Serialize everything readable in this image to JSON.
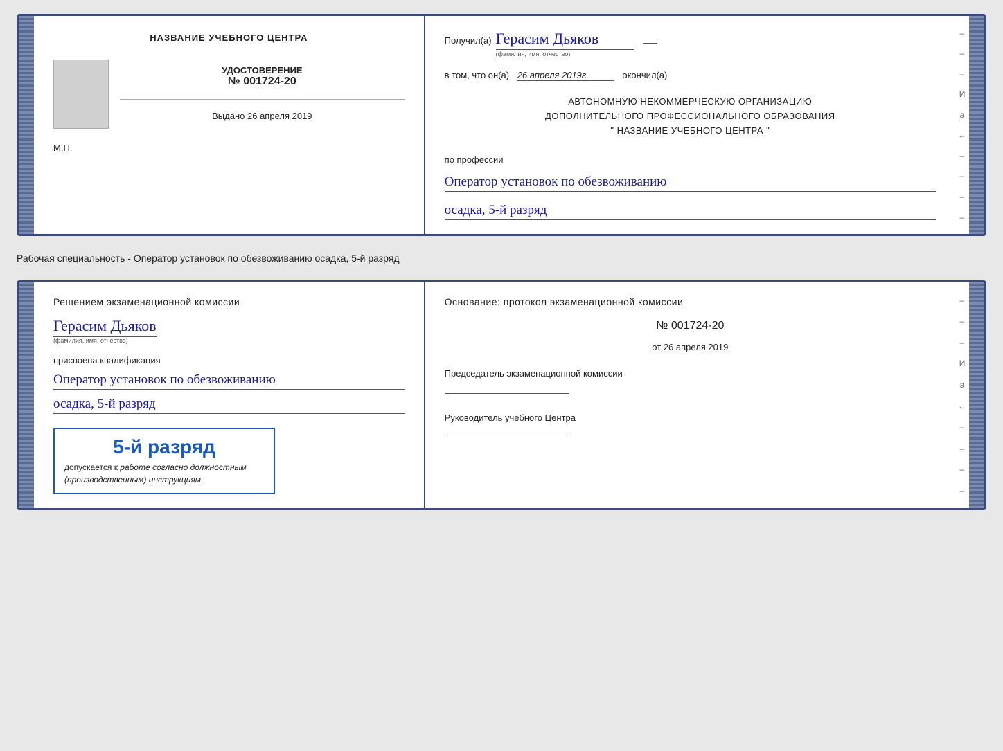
{
  "top_document": {
    "left": {
      "title": "НАЗВАНИЕ УЧЕБНОГО ЦЕНТРА",
      "cert_label": "УДОСТОВЕРЕНИЕ",
      "cert_number": "№ 001724-20",
      "issued_label": "Выдано",
      "issued_date": "26 апреля 2019",
      "mp_label": "М.П."
    },
    "right": {
      "received_label": "Получил(а)",
      "recipient_name": "Герасим Дьяков",
      "name_subtitle": "(фамилия, имя, отчество)",
      "date_label": "в том, что он(а)",
      "date_value": "26 апреля 2019г.",
      "finished_label": "окончил(а)",
      "org_line1": "АВТОНОМНУЮ НЕКОММЕРЧЕСКУЮ ОРГАНИЗАЦИЮ",
      "org_line2": "ДОПОЛНИТЕЛЬНОГО ПРОФЕССИОНАЛЬНОГО ОБРАЗОВАНИЯ",
      "org_line3": "\" НАЗВАНИЕ УЧЕБНОГО ЦЕНТРА \"",
      "profession_label": "по профессии",
      "profession_line1": "Оператор установок по обезвоживанию",
      "profession_line2": "осадка, 5-й разряд"
    }
  },
  "separator": {
    "text": "Рабочая специальность - Оператор установок по обезвоживанию осадка, 5-й разряд"
  },
  "bottom_document": {
    "left": {
      "commission_title": "Решением  экзаменационной  комиссии",
      "person_name": "Герасим Дьяков",
      "name_subtitle": "(фамилия, имя, отчество)",
      "qualification_label": "присвоена квалификация",
      "qualification_line1": "Оператор установок по обезвоживанию",
      "qualification_line2": "осадка, 5-й разряд",
      "stamp_rank": "5-й разряд",
      "stamp_prefix": "допускается к",
      "stamp_text": "работе согласно должностным (производственным) инструкциям"
    },
    "right": {
      "basis_label": "Основание: протокол экзаменационной  комиссии",
      "protocol_number": "№  001724-20",
      "date_prefix": "от",
      "date_value": "26 апреля 2019",
      "chairman_label": "Председатель экзаменационной комиссии",
      "director_label": "Руководитель учебного Центра"
    }
  },
  "right_marks": [
    "-",
    "-",
    "-",
    "И",
    "а",
    "←",
    "-",
    "-",
    "-",
    "-"
  ],
  "right_marks_bottom": [
    "-",
    "-",
    "-",
    "И",
    "а",
    "←",
    "-",
    "-",
    "-",
    "-"
  ]
}
